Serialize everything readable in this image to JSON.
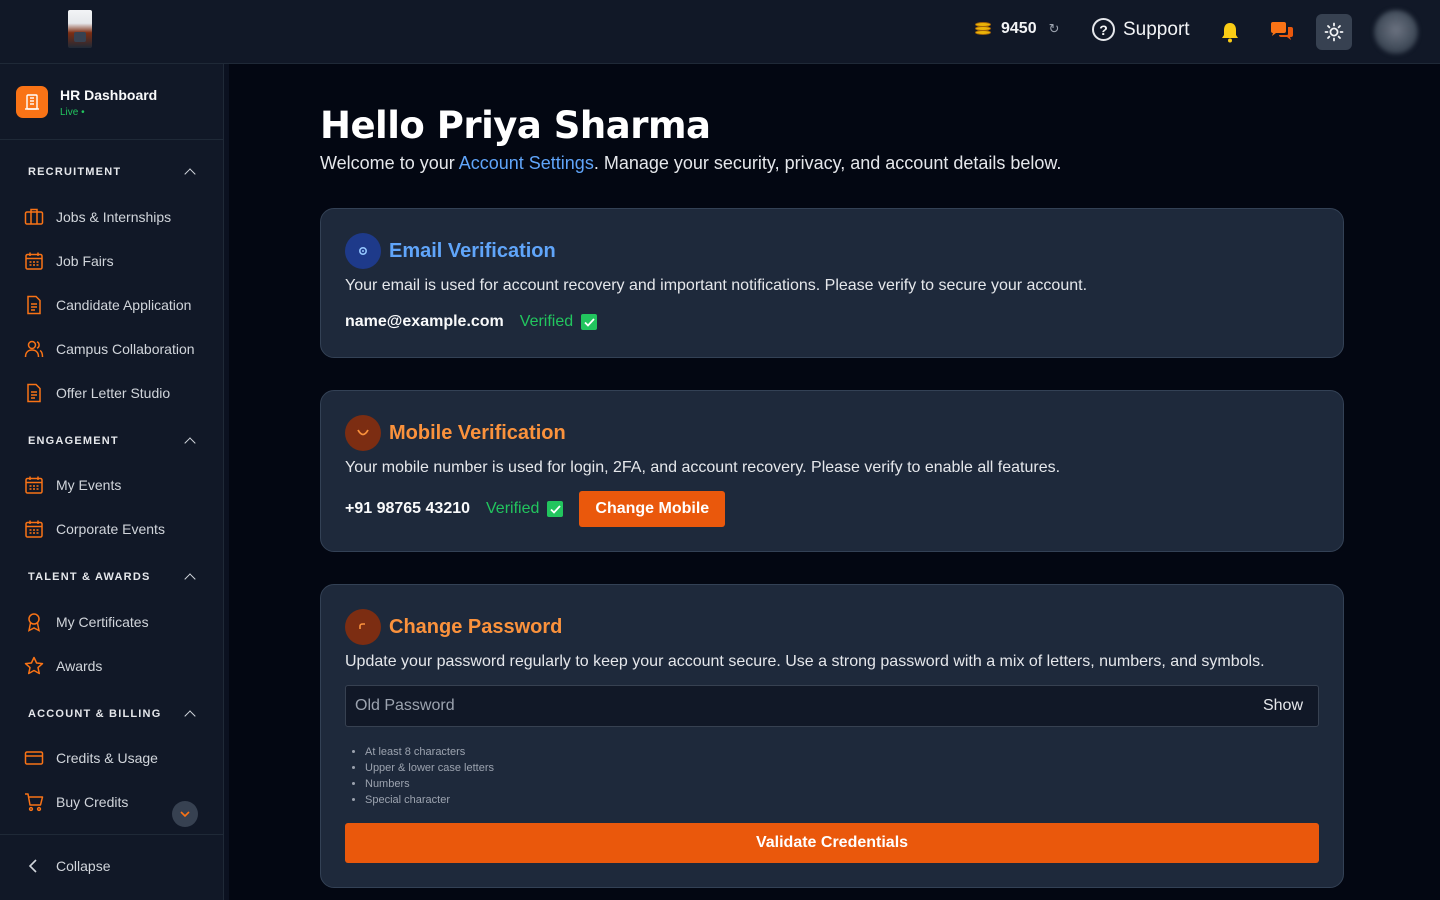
{
  "topbar": {
    "credits_value": "9450",
    "support_label": "Support",
    "icons": [
      "coins-icon",
      "refresh-icon",
      "help-icon",
      "bell-icon",
      "chat-icon",
      "sun-icon"
    ]
  },
  "sidebar": {
    "brand_title": "HR Dashboard",
    "brand_status": "Live",
    "sections": [
      {
        "label": "RECRUITMENT",
        "items": [
          "Jobs & Internships",
          "Job Fairs",
          "Candidate Application",
          "Campus Collaboration",
          "Offer Letter Studio"
        ]
      },
      {
        "label": "ENGAGEMENT",
        "items": [
          "My Events",
          "Corporate Events"
        ]
      },
      {
        "label": "TALENT & AWARDS",
        "items": [
          "My Certificates",
          "Awards"
        ]
      },
      {
        "label": "ACCOUNT & BILLING",
        "items": [
          "Credits & Usage",
          "Buy Credits"
        ]
      }
    ],
    "collapse_label": "Collapse"
  },
  "main": {
    "greeting": "Hello Priya Sharma",
    "welcome_prefix": "Welcome to your ",
    "welcome_link": "Account Settings",
    "welcome_suffix": ". Manage your security, privacy, and account details below.",
    "email_card": {
      "title": "Email Verification",
      "description": "Your email is used for account recovery and important notifications. Please verify to secure your account.",
      "value": "name@example.com",
      "status": "Verified"
    },
    "mobile_card": {
      "title": "Mobile Verification",
      "description": "Your mobile number is used for login, 2FA, and account recovery. Please verify to enable all features.",
      "value": "+91 98765 43210",
      "status": "Verified",
      "button": "Change Mobile"
    },
    "password_card": {
      "title": "Change Password",
      "description": "Update your password regularly to keep your account secure. Use a strong password with a mix of letters, numbers, and symbols.",
      "input_placeholder": "Old Password",
      "show_label": "Show",
      "rules": [
        "At least 8 characters",
        "Upper & lower case letters",
        "Numbers",
        "Special character"
      ],
      "button": "Validate Credentials"
    }
  },
  "colors": {
    "accent_orange": "#ea580c",
    "link_blue": "#60a5fa",
    "verified_green": "#22c55e",
    "email_title": "#60a5fa",
    "mobile_title": "#fb923c"
  }
}
